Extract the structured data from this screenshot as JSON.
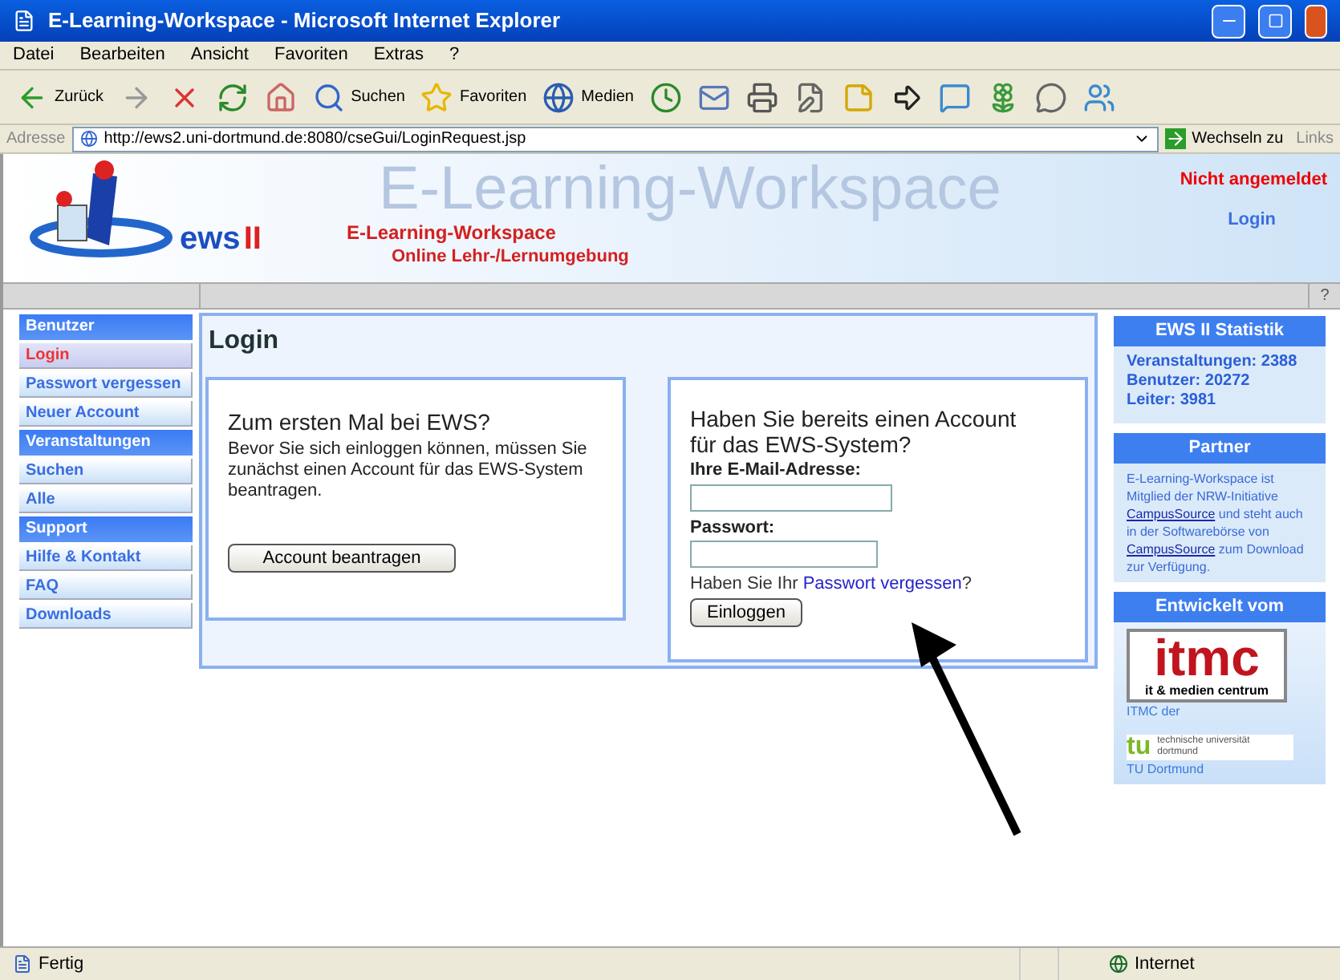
{
  "window": {
    "title": "E-Learning-Workspace - Microsoft Internet Explorer"
  },
  "menu": [
    "Datei",
    "Bearbeiten",
    "Ansicht",
    "Favoriten",
    "Extras",
    "?"
  ],
  "toolbar": [
    {
      "kind": "back",
      "label": "Zurück"
    },
    {
      "kind": "forward"
    },
    {
      "kind": "stop"
    },
    {
      "kind": "refresh"
    },
    {
      "kind": "home"
    },
    {
      "kind": "search",
      "label": "Suchen"
    },
    {
      "kind": "favorites",
      "label": "Favoriten"
    },
    {
      "kind": "media",
      "label": "Medien"
    },
    {
      "kind": "history"
    },
    {
      "kind": "mail"
    },
    {
      "kind": "print"
    },
    {
      "kind": "edit"
    },
    {
      "kind": "note"
    },
    {
      "kind": "forward-page"
    },
    {
      "kind": "messenger"
    },
    {
      "kind": "flower"
    },
    {
      "kind": "chat"
    },
    {
      "kind": "people"
    }
  ],
  "address": {
    "label": "Adresse",
    "value": "http://ews2.uni-dortmund.de:8080/cseGui/LoginRequest.jsp",
    "go": "Wechseln zu",
    "links": "Links"
  },
  "header": {
    "logo_text": "ews",
    "logo_suffix": "II",
    "backdrop": "E-Learning-Workspace",
    "title": "E-Learning-Workspace",
    "subtitle": "Online Lehr-/Lernumgebung",
    "status": "Nicht angemeldet",
    "login": "Login",
    "help": "?"
  },
  "sidebar": [
    {
      "kind": "section",
      "label": "Benutzer",
      "selected": false
    },
    {
      "kind": "link",
      "label": "Login",
      "selected": true
    },
    {
      "kind": "link",
      "label": "Passwort vergessen",
      "selected": false
    },
    {
      "kind": "link",
      "label": "Neuer Account",
      "selected": false
    },
    {
      "kind": "section",
      "label": "Veranstaltungen",
      "selected": false
    },
    {
      "kind": "link",
      "label": "Suchen",
      "selected": false
    },
    {
      "kind": "link",
      "label": "Alle",
      "selected": false
    },
    {
      "kind": "section",
      "label": "Support",
      "selected": false
    },
    {
      "kind": "link",
      "label": "Hilfe & Kontakt",
      "selected": false
    },
    {
      "kind": "link",
      "label": "FAQ",
      "selected": false
    },
    {
      "kind": "link",
      "label": "Downloads",
      "selected": false
    }
  ],
  "main": {
    "title": "Login",
    "register": {
      "heading": "Zum ersten Mal bei EWS?",
      "text": "Bevor Sie sich einloggen können, müssen Sie zunächst einen Account für das EWS-System beantragen.",
      "button": "Account beantragen"
    },
    "login": {
      "heading": "Haben Sie bereits einen Account für das EWS-System?",
      "email_label": "Ihre E-Mail-Adresse:",
      "password_label": "Passwort:",
      "forgot_prefix": "Haben Sie Ihr",
      "forgot_link": "Passwort vergessen",
      "forgot_suffix": "?",
      "button": "Einloggen"
    }
  },
  "right": {
    "stats": {
      "title": "EWS II Statistik",
      "lines": [
        "Veranstaltungen: 2388",
        "Benutzer: 20272",
        "Leiter: 3981"
      ]
    },
    "partner": {
      "title": "Partner",
      "parts": [
        {
          "kind": "text",
          "text": "E-Learning-Workspace ist Mitglied der NRW-Initiative"
        },
        {
          "kind": "link",
          "text": "CampusSource"
        },
        {
          "kind": "text",
          "text": "und steht auch in der Softwarebörse von"
        },
        {
          "kind": "link",
          "text": "CampusSource"
        },
        {
          "kind": "text",
          "text": "zum Download zur Verfügung."
        }
      ]
    },
    "developer": {
      "title": "Entwickelt vom",
      "itmc_logo": "itmc",
      "itmc_sub": "it & medien centrum",
      "itmc_caption": "ITMC der",
      "tu_logo": "tu",
      "tu_name": "technische universität dortmund",
      "tu_caption": "TU Dortmund"
    }
  },
  "status_bar": {
    "text": "Fertig",
    "zone": "Internet"
  }
}
